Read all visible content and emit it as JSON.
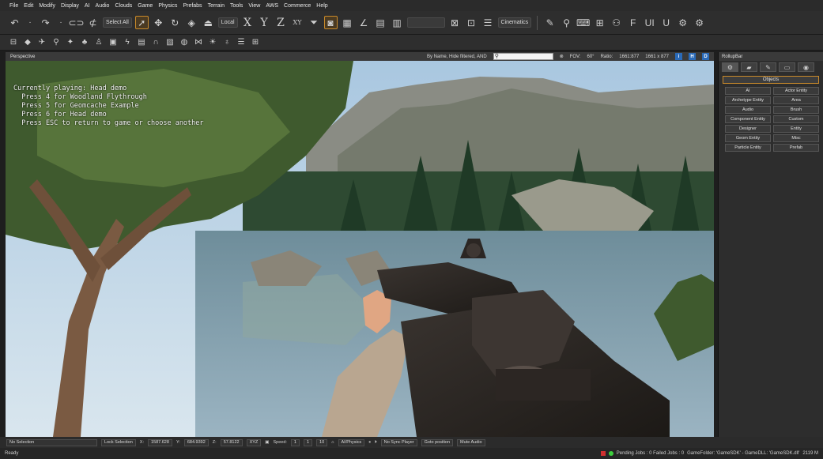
{
  "menu": [
    "File",
    "Edit",
    "Modify",
    "Display",
    "AI",
    "Audio",
    "Clouds",
    "Game",
    "Physics",
    "Prefabs",
    "Terrain",
    "Tools",
    "View",
    "AWS",
    "Commerce",
    "Help"
  ],
  "toolbar": {
    "select_all": "Select All",
    "coord_system": "Local",
    "axes": [
      "X",
      "Y",
      "Z",
      "XY"
    ],
    "cinematics": "Cinematics"
  },
  "viewport": {
    "title": "Perspective",
    "filter_text": "By Name, Hide filtered, AND",
    "fov_label": "FOV:",
    "fov_value": "60°",
    "ratio_label": "Ratio:",
    "ratio_value": "1661:877",
    "resolution": "1661 x 877",
    "buttons": [
      "i",
      "H",
      "D"
    ]
  },
  "console_lines": [
    "Currently playing: Head demo",
    "  Press 4 for Woodland Flythrough",
    "  Press 5 for Geomcache Example",
    "  Press 6 for Head demo",
    "",
    "  Press ESC to return to game or choose another"
  ],
  "rollup": {
    "title": "RollupBar",
    "objects_header": "Objects",
    "buttons": [
      "AI",
      "Actor Entity",
      "Archetype Entity",
      "Area",
      "Audio",
      "Brush",
      "Component Entity",
      "Custom",
      "Designer",
      "Entity",
      "Geom Entity",
      "Misc",
      "Particle Entity",
      "Prefab"
    ]
  },
  "statusbar": {
    "selection": "No Selection",
    "lock_selection": "Lock Selection",
    "x_label": "X:",
    "x_value": "1587.628",
    "y_label": "Y:",
    "y_value": "684.9392",
    "z_label": "Z:",
    "z_value": "57.8122",
    "xyz_label": "XYZ",
    "speed_label": "Speed:",
    "speed_value": "1",
    "speed_presets": [
      "1",
      "10"
    ],
    "ai_physics": "AI/Physics",
    "no_sync_player": "No Sync Player",
    "goto_position": "Goto position",
    "mute_audio": "Mute Audio"
  },
  "readybar": {
    "status": "Ready",
    "jobs": "Pending Jobs : 0  Failed Jobs : 0",
    "game_folder": "GameFolder: 'GameSDK' - GameDLL: 'GameSDK.dll'",
    "memory": "2119 M"
  },
  "colors": {
    "accent_orange": "#c98a2a",
    "status_green": "#3ecf3e",
    "status_red": "#d03030",
    "ui_dark": "#2d2d2d"
  }
}
